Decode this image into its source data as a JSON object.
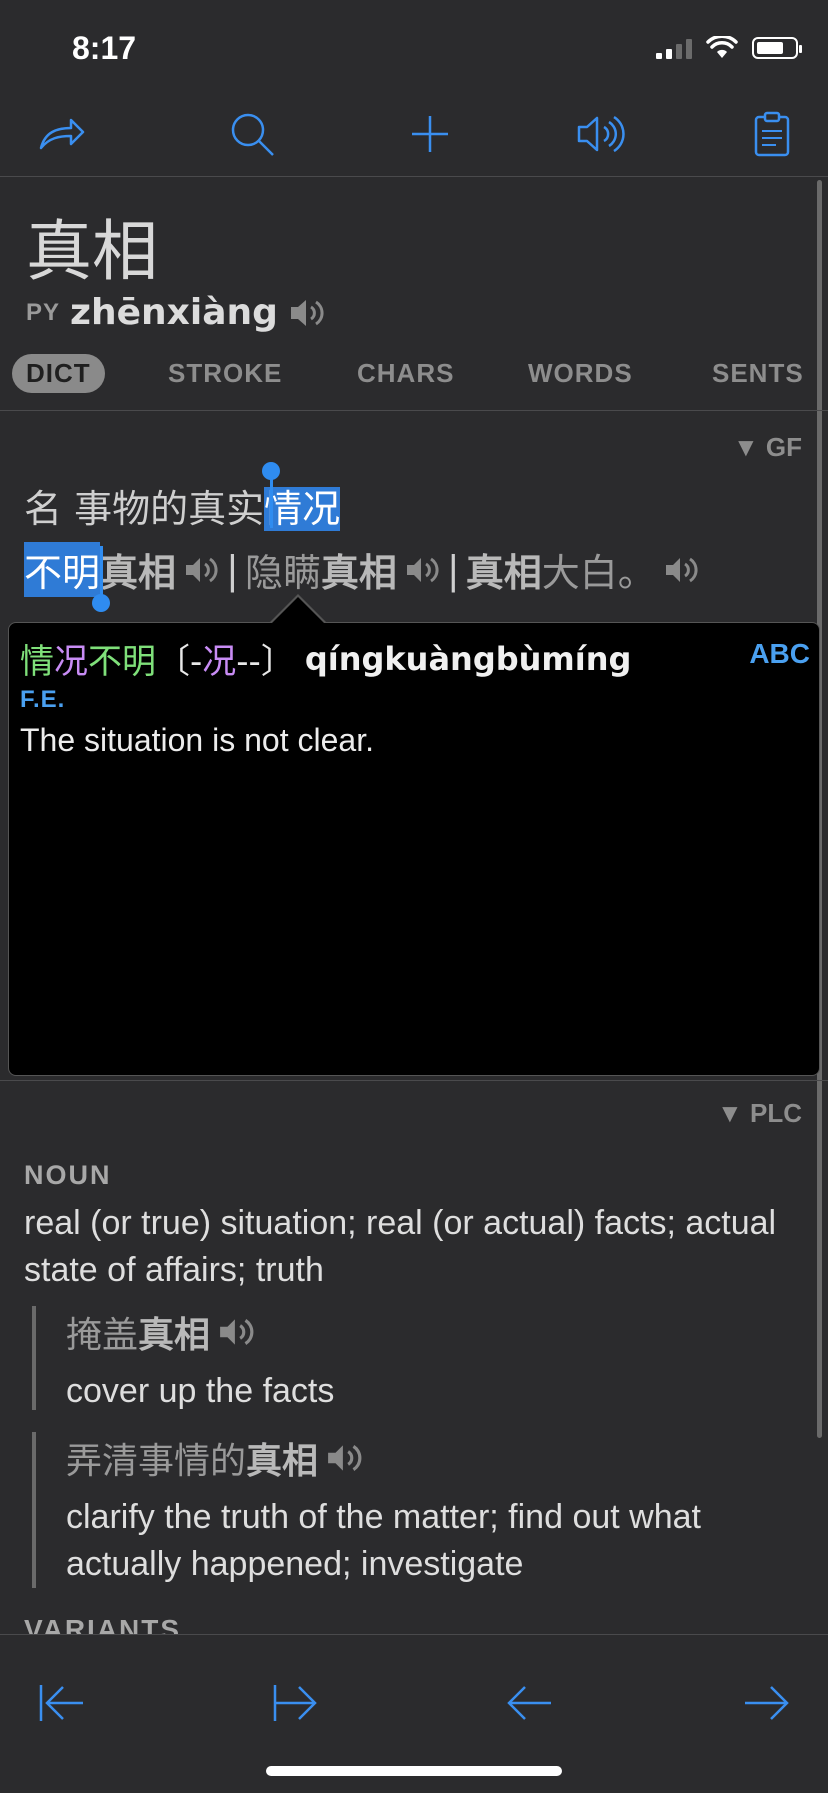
{
  "status": {
    "time": "8:17"
  },
  "toolbar": {
    "icons": [
      "share-icon",
      "search-icon",
      "add-icon",
      "speaker-icon",
      "clipboard-icon"
    ],
    "accent": "#3a8ff0"
  },
  "entry": {
    "headword": "真相",
    "py_label": "PY",
    "pinyin": "zhēnxiàng"
  },
  "tabs": [
    "DICT",
    "STROKE",
    "CHARS",
    "WORDS",
    "SENTS"
  ],
  "gf": {
    "source": "▼ GF",
    "line1_pre": "名 事物的真实",
    "line1_hl": "情况",
    "line2_hl": "不明",
    "line2_b1": "真相",
    "pipe": "|",
    "line2_p2": "隐瞒",
    "line2_b2": "真相",
    "line2_b3": "真相",
    "line2_p3": "大白。"
  },
  "popup": {
    "c1": "情",
    "c2": "况",
    "c3": "不明",
    "trad_open": "〔-",
    "trad_mid": "况",
    "trad_close": "--〕",
    "pinyin": "qíngkuàngbùmíng",
    "abc": "ABC",
    "label": "F.E.",
    "definition": "The situation is not clear."
  },
  "plc": {
    "source": "▼ PLC",
    "pos": "NOUN",
    "definition": "real (or true) situation; real (or actual) facts; actual state of affairs; truth",
    "examples": [
      {
        "zh_pre": "掩盖",
        "zh_b": "真相",
        "zh_post": "",
        "en": "cover up the facts"
      },
      {
        "zh_pre": "弄清事情的",
        "zh_b": "真相",
        "zh_post": "",
        "en": "clarify the truth of the matter; find out what actually happened; investigate"
      }
    ],
    "variants_label": "VARIANTS"
  },
  "bottom_nav": [
    "first-page-icon",
    "last-page-icon",
    "back-arrow-icon",
    "forward-arrow-icon"
  ]
}
